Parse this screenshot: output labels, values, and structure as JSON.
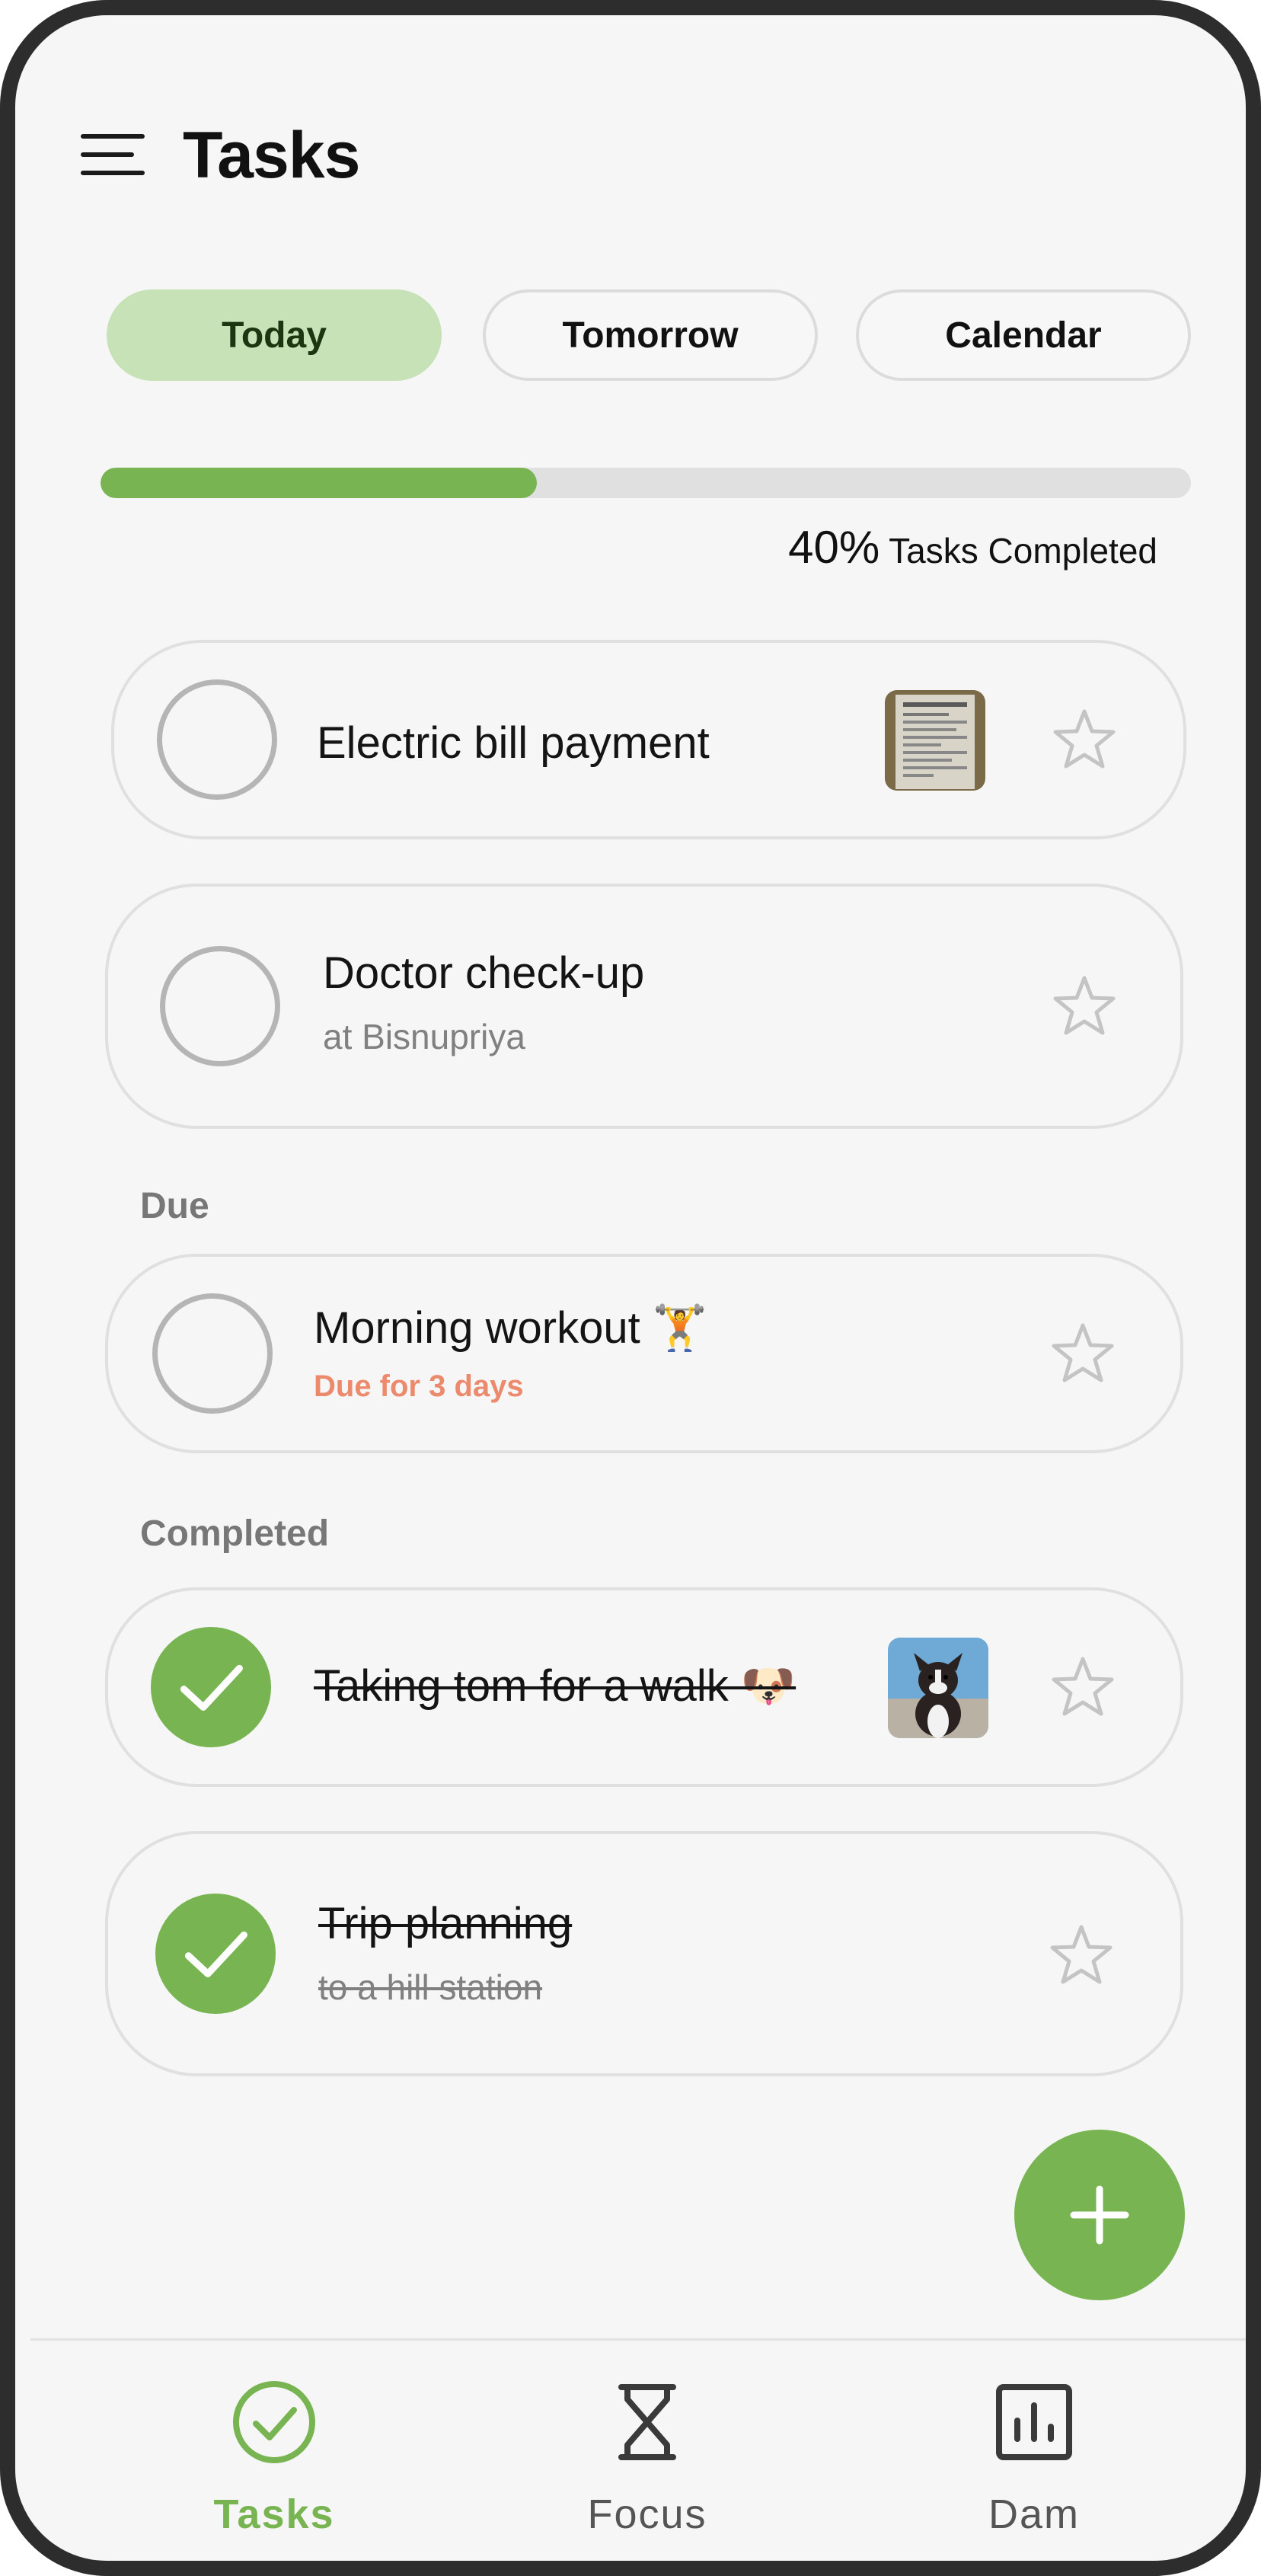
{
  "header": {
    "title": "Tasks",
    "menu_icon": "menu-icon"
  },
  "tabs": [
    {
      "label": "Today",
      "active": true
    },
    {
      "label": "Tomorrow",
      "active": false
    },
    {
      "label": "Calendar",
      "active": false
    }
  ],
  "progress": {
    "percent_label": "40%",
    "suffix": "Tasks Completed",
    "value": 0.4
  },
  "tasks": [
    {
      "title": "Electric bill payment",
      "has_image": true,
      "image_icon": "receipt-photo",
      "completed": false
    },
    {
      "title": "Doctor check-up",
      "subtitle": "at Bisnupriya",
      "completed": false
    }
  ],
  "sections": {
    "due": {
      "label": "Due",
      "tasks": [
        {
          "title": "Morning workout 🏋",
          "due_text": "Due for 3 days",
          "completed": false
        }
      ]
    },
    "completed": {
      "label": "Completed",
      "tasks": [
        {
          "title": "Taking tom for a walk 🐶",
          "has_image": true,
          "image_icon": "dog-photo",
          "completed": true
        },
        {
          "title": "Trip planning",
          "subtitle": "to a hill station",
          "completed": true
        }
      ]
    }
  },
  "fab": {
    "icon": "plus-icon"
  },
  "bottom_nav": [
    {
      "label": "Tasks",
      "icon": "check-circle-icon",
      "active": true
    },
    {
      "label": "Focus",
      "icon": "hourglass-icon",
      "active": false
    },
    {
      "label": "Dam",
      "icon": "bar-chart-icon",
      "active": false
    }
  ],
  "colors": {
    "accent": "#78b552",
    "tab_active_bg": "#c7e2b7",
    "due_text": "#ec8a6d",
    "muted_text": "#808080"
  }
}
